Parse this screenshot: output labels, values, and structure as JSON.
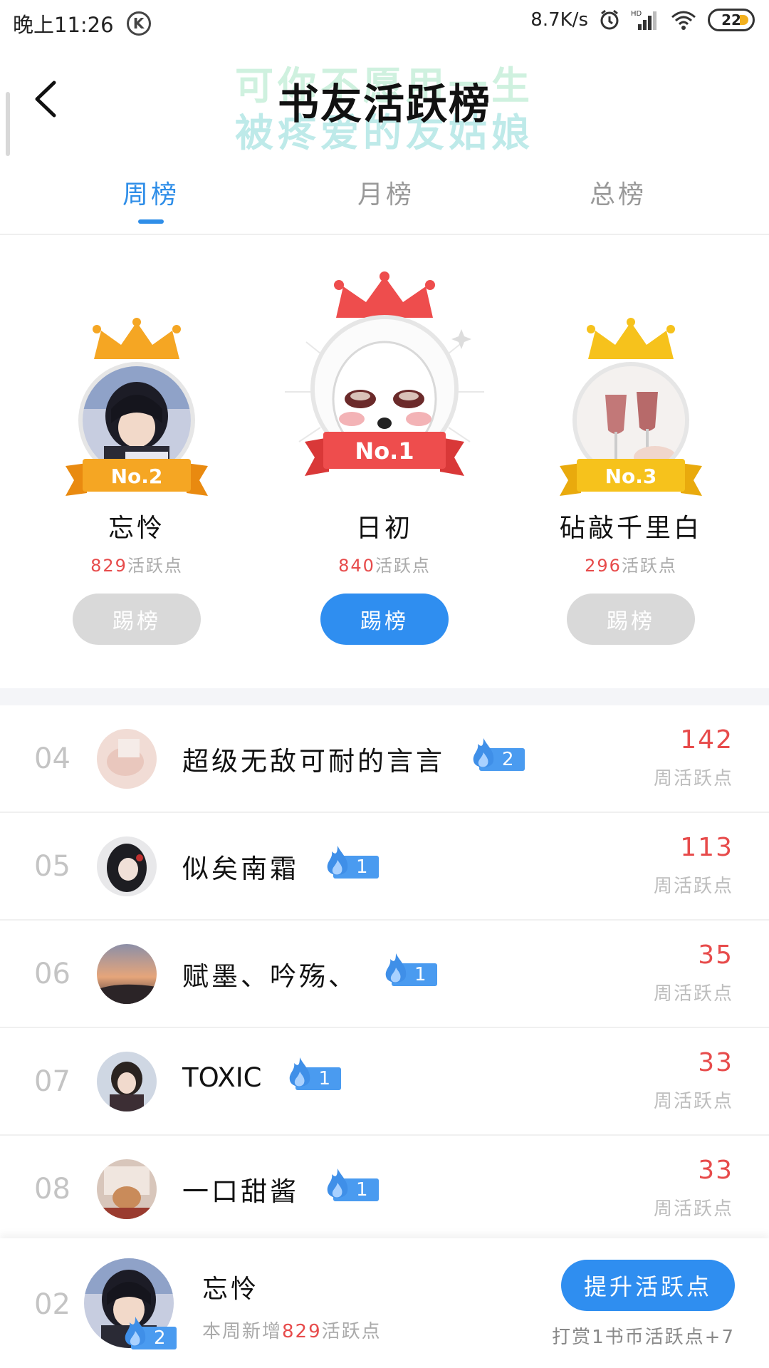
{
  "status_bar": {
    "time": "晚上11:26",
    "k_label": "K",
    "net_speed": "8.7K/s",
    "hd_label": "HD",
    "battery": "22"
  },
  "header": {
    "title": "书友活跃榜",
    "watermark_line1": "可你不愿用一生",
    "watermark_line2": "被疼爱的友姑娘"
  },
  "tabs": [
    {
      "label": "周榜",
      "active": true
    },
    {
      "label": "月榜",
      "active": false
    },
    {
      "label": "总榜",
      "active": false
    }
  ],
  "podium": {
    "second": {
      "rank_label": "No.2",
      "name": "忘怜",
      "points": "829",
      "points_suffix": "活跃点",
      "button": "踢榜"
    },
    "first": {
      "rank_label": "No.1",
      "name": "日初",
      "points": "840",
      "points_suffix": "活跃点",
      "button": "踢榜"
    },
    "third": {
      "rank_label": "No.3",
      "name": "砧敲千里白",
      "points": "296",
      "points_suffix": "活跃点",
      "button": "踢榜"
    }
  },
  "list": [
    {
      "rank": "04",
      "name": "超级无敌可耐的言言",
      "level": "2",
      "score": "142",
      "sub": "周活跃点"
    },
    {
      "rank": "05",
      "name": "似矣南霜",
      "level": "1",
      "score": "113",
      "sub": "周活跃点"
    },
    {
      "rank": "06",
      "name": "赋墨、吟殇、",
      "level": "1",
      "score": "35",
      "sub": "周活跃点"
    },
    {
      "rank": "07",
      "name": "TOXIC",
      "level": "1",
      "score": "33",
      "sub": "周活跃点"
    },
    {
      "rank": "08",
      "name": "一口甜酱",
      "level": "1",
      "score": "33",
      "sub": "周活跃点"
    }
  ],
  "my_bar": {
    "rank": "02",
    "name": "忘怜",
    "level": "2",
    "sub_prefix": "本周新增",
    "sub_points": "829",
    "sub_suffix": "活跃点",
    "button": "提升活跃点",
    "note": "打赏1书币活跃点+7"
  },
  "colors": {
    "accent_blue": "#2f8ee8",
    "score_red": "#e74b4b",
    "crown_orange": "#f5a623",
    "crown_red": "#ee4d4d",
    "crown_gold": "#f6c21c"
  },
  "icons": {
    "back": "back-arrow-icon",
    "flame": "flame-icon",
    "crown": "crown-icon",
    "wifi": "wifi-icon",
    "signal": "signal-icon",
    "alarm": "alarm-icon"
  }
}
